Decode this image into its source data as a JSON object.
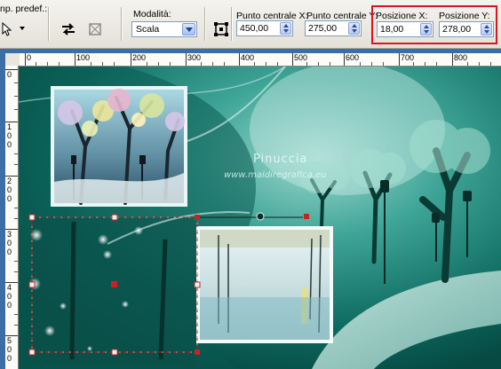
{
  "toolbar": {
    "preset_label": "np. predef.:",
    "mode_label": "Modalità:",
    "mode_value": "Scala",
    "center_x_label": "Punto centrale X:",
    "center_x_value": "450,00",
    "center_y_label": "Punto centrale Y:",
    "center_y_value": "275,00",
    "pos_x_label": "Posizione X:",
    "pos_x_value": "18,00",
    "pos_y_label": "Posizione Y:",
    "pos_y_value": "278,00"
  },
  "ruler_top": [
    "0",
    "100",
    "200",
    "300",
    "400",
    "500",
    "600",
    "700",
    "800"
  ],
  "ruler_left": [
    [
      "0"
    ],
    [
      "1",
      "0",
      "0"
    ],
    [
      "2",
      "0",
      "0"
    ],
    [
      "3",
      "0",
      "0"
    ],
    [
      "4",
      "0",
      "0"
    ],
    [
      "5",
      "0",
      "0"
    ]
  ],
  "canvas": {
    "watermark_name": "Pinuccia",
    "watermark_url": "www.maidiregrafica.eu"
  },
  "colors": {
    "highlight": "#e0131b",
    "canvas_bg": "#0f6b62",
    "window_border": "#3a6ea5"
  }
}
